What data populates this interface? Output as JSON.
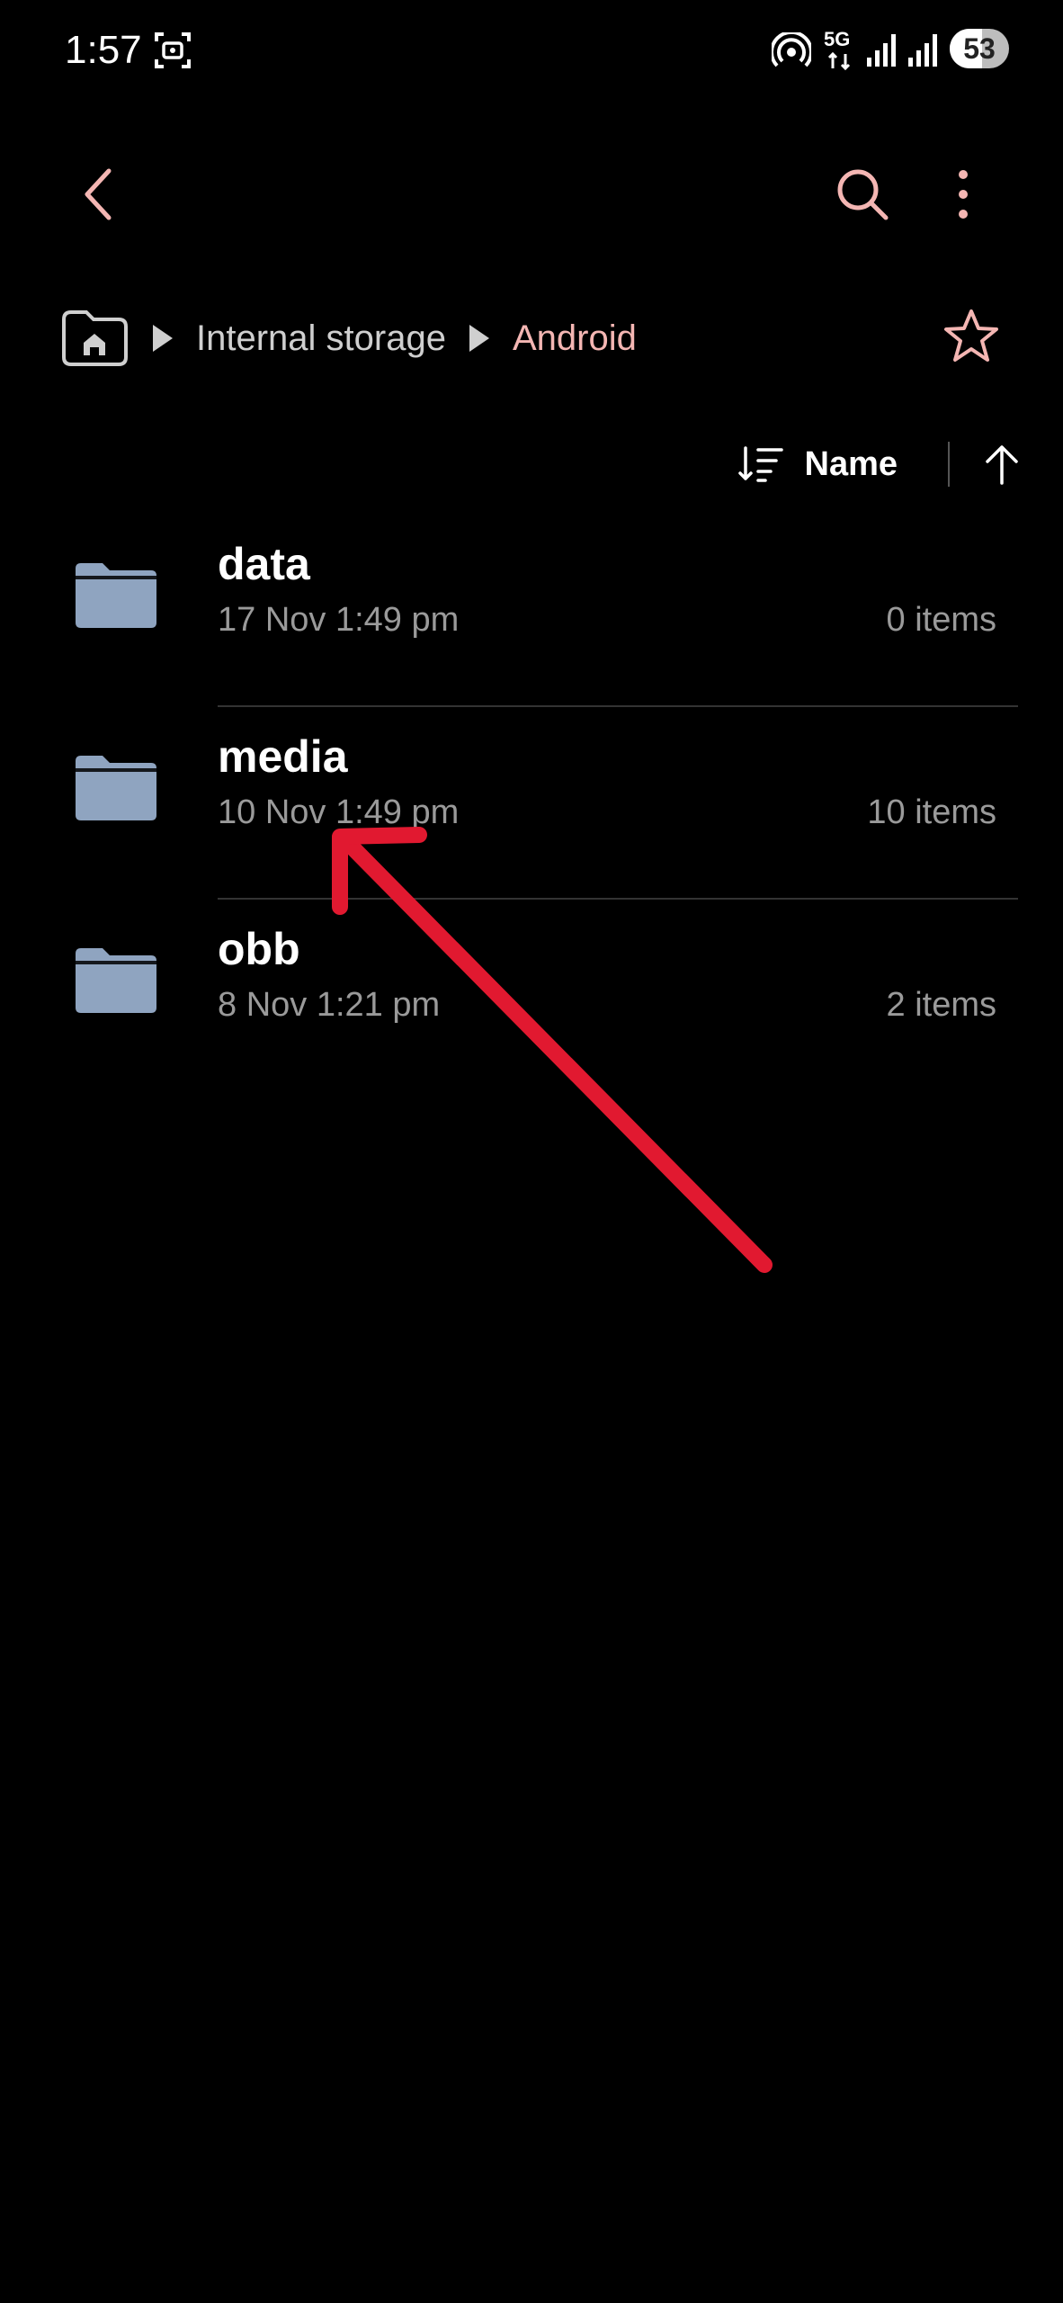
{
  "status_bar": {
    "time": "1:57",
    "network_label": "5G",
    "battery_level": "53",
    "icons": [
      "screen-record-icon",
      "hotspot-icon",
      "5g-icon",
      "signal-icon",
      "signal-icon",
      "battery-icon"
    ]
  },
  "app_bar": {
    "icons": [
      "back-arrow-icon",
      "search-icon",
      "more-options-icon"
    ],
    "accent_color": "#f4b6b3"
  },
  "breadcrumb": {
    "items": [
      {
        "label": "Internal storage",
        "color": "#cfcfcf"
      },
      {
        "label": "Android",
        "color": "#f4b6b3"
      }
    ],
    "home_icon": "home-folder-icon",
    "favorite_icon": "star-icon"
  },
  "sort": {
    "label": "Name",
    "sort_icon": "sort-icon",
    "direction_icon": "arrow-up-icon"
  },
  "files": [
    {
      "name": "data",
      "date": "17 Nov 1:49 pm",
      "count": "0 items"
    },
    {
      "name": "media",
      "date": "10 Nov 1:49 pm",
      "count": "10 items"
    },
    {
      "name": "obb",
      "date": "8 Nov 1:21 pm",
      "count": "2 items"
    }
  ],
  "colors": {
    "folder": "#8fa4c0",
    "annotation_arrow": "#e11930",
    "background": "#000000"
  }
}
